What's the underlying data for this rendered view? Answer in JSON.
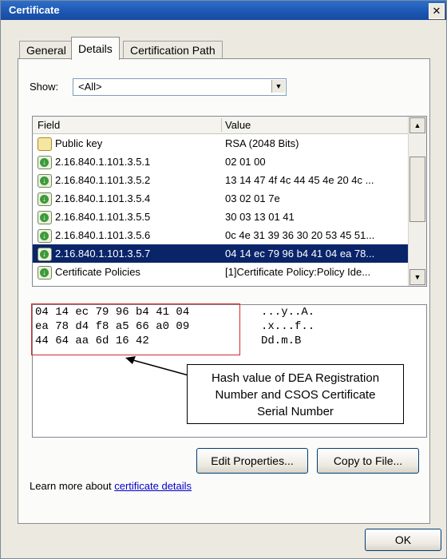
{
  "window": {
    "title": "Certificate",
    "close_glyph": "✕"
  },
  "tabs": [
    {
      "label": "General"
    },
    {
      "label": "Details"
    },
    {
      "label": "Certification Path"
    }
  ],
  "show": {
    "label": "Show:",
    "value": "<All>"
  },
  "list": {
    "columns": {
      "field": "Field",
      "value": "Value"
    },
    "rows": [
      {
        "field": "Public key",
        "value": "RSA (2048 Bits)",
        "icon": "key-icon"
      },
      {
        "field": "2.16.840.1.101.3.5.1",
        "value": "02 01 00",
        "icon": "extension-icon"
      },
      {
        "field": "2.16.840.1.101.3.5.2",
        "value": "13 14 47 4f 4c 44 45 4e 20 4c ...",
        "icon": "extension-icon"
      },
      {
        "field": "2.16.840.1.101.3.5.4",
        "value": "03 02 01 7e",
        "icon": "extension-icon"
      },
      {
        "field": "2.16.840.1.101.3.5.5",
        "value": "30 03 13 01 41",
        "icon": "extension-icon"
      },
      {
        "field": "2.16.840.1.101.3.5.6",
        "value": "0c 4e 31 39 36 30 20 53 45 51...",
        "icon": "extension-icon"
      },
      {
        "field": "2.16.840.1.101.3.5.7",
        "value": "04 14 ec 79 96 b4 41 04 ea 78...",
        "icon": "extension-icon",
        "selected": true
      },
      {
        "field": "Certificate Policies",
        "value": "[1]Certificate Policy:Policy Ide...",
        "icon": "extension-icon"
      }
    ]
  },
  "hex": {
    "lines": [
      "04 14 ec 79 96 b4 41 04",
      "ea 78 d4 f8 a5 66 a0 09",
      "44 64 aa 6d 16 42"
    ],
    "ascii": [
      "...y..A.",
      ".x...f..",
      "Dd.m.B"
    ]
  },
  "callout": {
    "line1": "Hash value of DEA Registration",
    "line2": "Number and CSOS Certificate",
    "line3": "Serial Number"
  },
  "buttons": {
    "edit_properties": "Edit Properties...",
    "copy_to_file": "Copy to File...",
    "ok": "OK"
  },
  "learn": {
    "prefix": "Learn more about ",
    "link": "certificate details"
  },
  "colors": {
    "selection": "#0a246a",
    "callout_box": "#d22b2b",
    "title_bar": "#1c56b0"
  }
}
